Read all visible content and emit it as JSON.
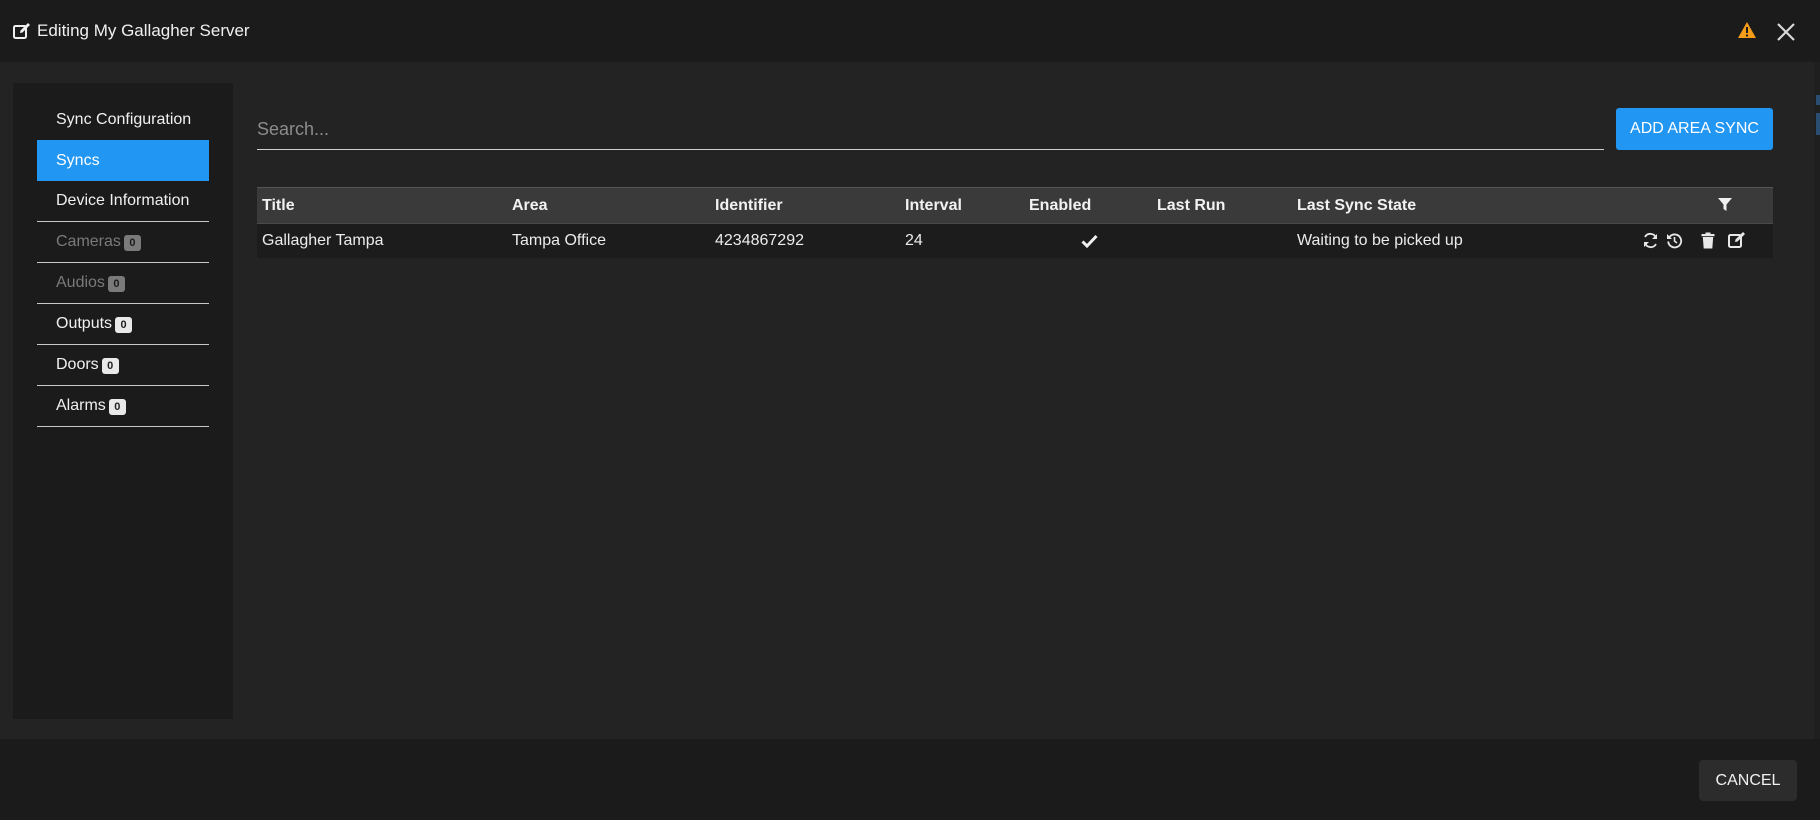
{
  "header": {
    "title": "Editing My Gallagher Server"
  },
  "sidebar": {
    "items": [
      {
        "label": "Sync Configuration",
        "count": null
      },
      {
        "label": "Syncs",
        "count": null
      },
      {
        "label": "Device Information",
        "count": null
      },
      {
        "label": "Cameras",
        "count": "0"
      },
      {
        "label": "Audios",
        "count": "0"
      },
      {
        "label": "Outputs",
        "count": "0"
      },
      {
        "label": "Doors",
        "count": "0"
      },
      {
        "label": "Alarms",
        "count": "0"
      }
    ],
    "active_item": "Syncs",
    "disabled_items": [
      "Cameras",
      "Audios"
    ]
  },
  "search": {
    "placeholder": "Search...",
    "value": ""
  },
  "toolbar": {
    "add_label": "ADD AREA SYNC"
  },
  "table": {
    "columns": [
      "Title",
      "Area",
      "Identifier",
      "Interval",
      "Enabled",
      "Last Run",
      "Last Sync State"
    ],
    "rows": [
      {
        "title": "Gallagher Tampa",
        "area": "Tampa Office",
        "identifier": "4234867292",
        "interval": "24",
        "enabled": true,
        "last_run": "",
        "last_sync_state": "Waiting to be picked up"
      }
    ]
  },
  "footer": {
    "cancel_label": "CANCEL"
  },
  "colors": {
    "accent": "#2196f3",
    "warning": "#f59c1a",
    "background": "#232323",
    "panel": "#1b1b1b",
    "header_row": "#3a3a3a"
  },
  "icons": {
    "title": "edit-icon",
    "warning": "warning-icon",
    "close": "close-icon",
    "filter": "filter-icon",
    "enabled": "check-icon",
    "row_actions": [
      "sync-icon",
      "history-icon",
      "trash-icon",
      "edit-icon"
    ]
  }
}
